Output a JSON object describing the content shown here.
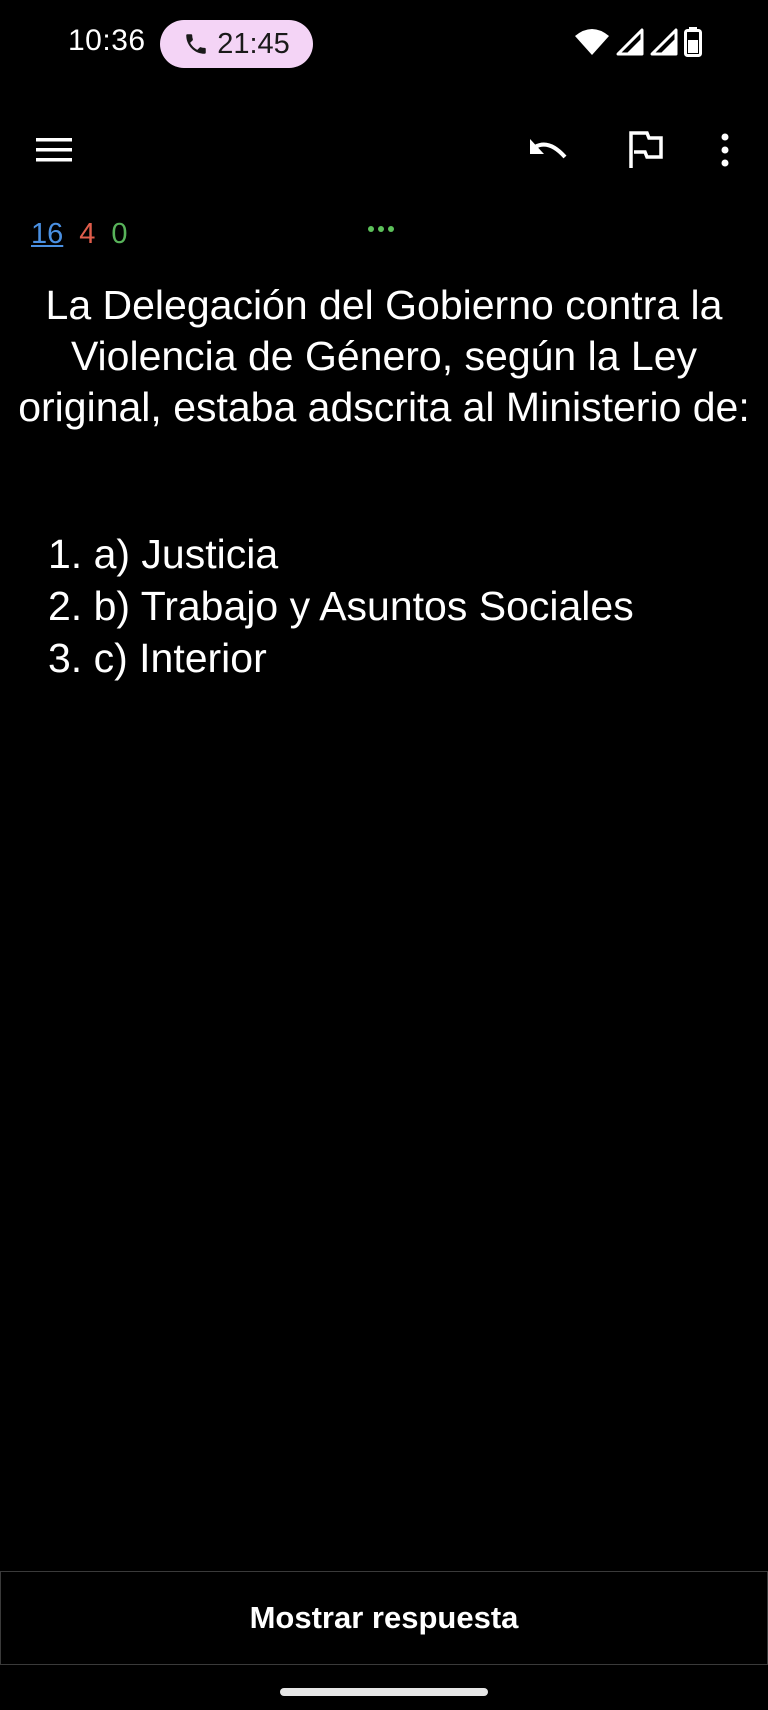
{
  "status_bar": {
    "time": "10:36",
    "call_duration": "21:45",
    "icons": [
      "wifi-icon",
      "signal-icon",
      "signal-icon",
      "battery-icon"
    ]
  },
  "toolbar": {
    "icons": [
      "menu-icon",
      "undo-icon",
      "flag-icon",
      "more-vert-icon"
    ]
  },
  "counts": {
    "new": "16",
    "learning": "4",
    "review": "0"
  },
  "colors": {
    "new": "#4a90e2",
    "learning": "#e05d4b",
    "review": "#58b35a",
    "pill": "#f4d4f6"
  },
  "card": {
    "question": "La Delegación del Gobierno contra la Violencia de Género, según la Ley original, estaba adscrita al Ministerio de:",
    "options": [
      "1. a) Justicia",
      "2. b) Trabajo y Asuntos Sociales",
      "3. c) Interior"
    ]
  },
  "answer_button": {
    "label": "Mostrar respuesta"
  }
}
